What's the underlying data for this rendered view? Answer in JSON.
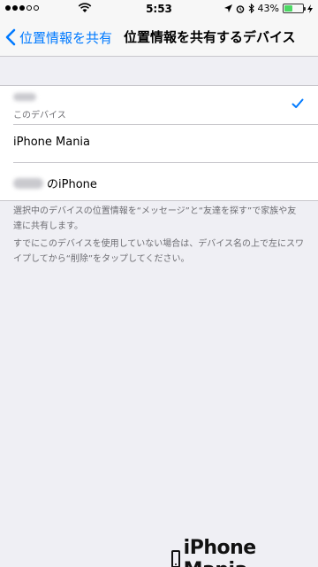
{
  "status_bar": {
    "time": "5:53",
    "battery_percent": "43%",
    "signal_bars_filled": 3,
    "signal_bars_total": 5
  },
  "nav": {
    "back_label": "位置情報を共有",
    "title": "位置情報を共有するデバイス"
  },
  "devices": [
    {
      "name": "",
      "subtitle": "このデバイス",
      "selected": true,
      "blurred_name": true
    },
    {
      "name": "iPhone Mania",
      "selected": false
    },
    {
      "name": "のiPhone",
      "selected": false,
      "blurred_prefix": true
    }
  ],
  "footer": {
    "paragraph1": "選択中のデバイスの位置情報を“メッセージ”と“友達を探す”で家族や友達に共有します。",
    "paragraph2": "すでにこのデバイスを使用していない場合は、デバイス名の上で左にスワイプしてから“削除”をタップしてください。"
  },
  "watermark": {
    "text": "iPhone Mania"
  },
  "colors": {
    "accent": "#007aff",
    "background": "#efeff4",
    "battery": "#4cd964"
  }
}
